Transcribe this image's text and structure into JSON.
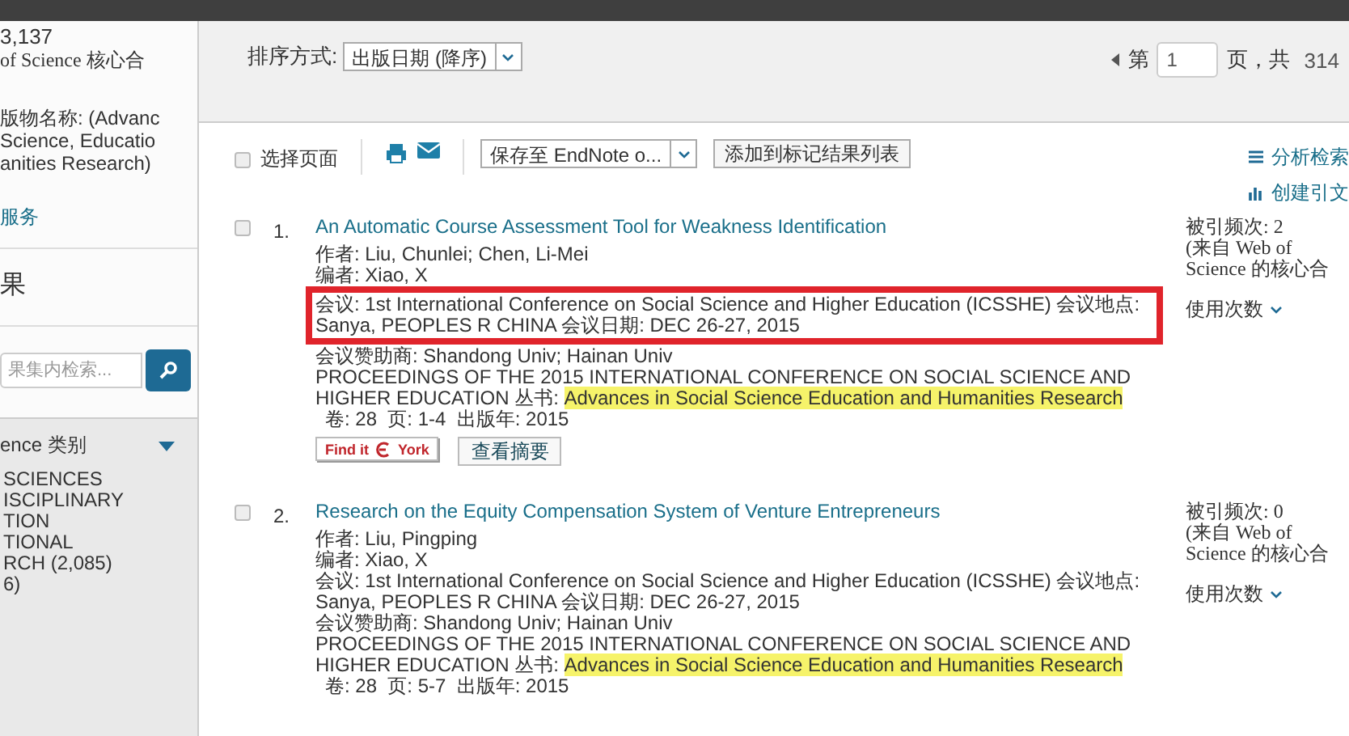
{
  "sidebar": {
    "summary": [
      "3,137",
      "of Science 核心合"
    ],
    "refine_lines": [
      "版物名称: (Advanc",
      "Science, Educatio",
      "anities Research)"
    ],
    "link": "服务",
    "section_title": "果",
    "search": {
      "placeholder": "果集内检索..."
    },
    "category": {
      "title": "ence 类别",
      "expanded": true,
      "lines": [
        "SCIENCES",
        "ISCIPLINARY",
        "TION",
        "TIONAL",
        "RCH (2,085)",
        "6)"
      ]
    }
  },
  "sort": {
    "label": "排序方式:",
    "value": "出版日期 (降序)"
  },
  "pager": {
    "prefix": "第",
    "page": "1",
    "suffix": "页，共",
    "total": "314"
  },
  "toolbar": {
    "select_page": {
      "label": "选择页面",
      "checked": false
    },
    "save": "保存至 EndNote o...",
    "add": "添加到标记结果列表",
    "links": [
      "分析检索",
      "创建引文"
    ]
  },
  "records": [
    {
      "number": "1.",
      "checked": false,
      "title": "An Automatic Course Assessment Tool for Weakness Identification",
      "authors": "作者: Liu, Chunlei; Chen, Li-Mei",
      "editors": "编者: Xiao, X",
      "conference": "会议: 1st International Conference on Social Science and Higher Education (ICSSHE) 会议地点: Sanya, PEOPLES R CHINA 会议日期: DEC 26-27, 2015",
      "highlighted": true,
      "sponsor": "会议赞助商: Shandong Univ; Hainan Univ",
      "source": "PROCEEDINGS OF THE 2015 INTERNATIONAL CONFERENCE ON SOCIAL SCIENCE AND HIGHER EDUCATION",
      "series_label": "丛书:",
      "series": "Advances in Social Science Education and Humanities Research",
      "volume_info": "卷: 28  页: 1-4  出版年: 2015",
      "findit": [
        "Find it",
        "York"
      ],
      "abstract_button": "查看摘要",
      "times_cited": "被引频次: 2",
      "cited_source": "(来自 Web of Science 的核心合",
      "usage": "使用次数"
    },
    {
      "number": "2.",
      "checked": false,
      "title": "Research on the Equity Compensation System of Venture Entrepreneurs",
      "authors": "作者: Liu, Pingping",
      "editors": "编者: Xiao, X",
      "conference": "会议: 1st International Conference on Social Science and Higher Education (ICSSHE) 会议地点: Sanya, PEOPLES R CHINA 会议日期: DEC 26-27, 2015",
      "highlighted": false,
      "sponsor": "会议赞助商: Shandong Univ; Hainan Univ",
      "source": "PROCEEDINGS OF THE 2015 INTERNATIONAL CONFERENCE ON SOCIAL SCIENCE AND HIGHER EDUCATION",
      "series_label": "丛书:",
      "series": "Advances in Social Science Education and Humanities Research",
      "volume_info": "卷: 28  页: 5-7  出版年: 2015",
      "times_cited": "被引频次: 0",
      "cited_source": "(来自 Web of Science 的核心合",
      "usage": "使用次数"
    }
  ]
}
